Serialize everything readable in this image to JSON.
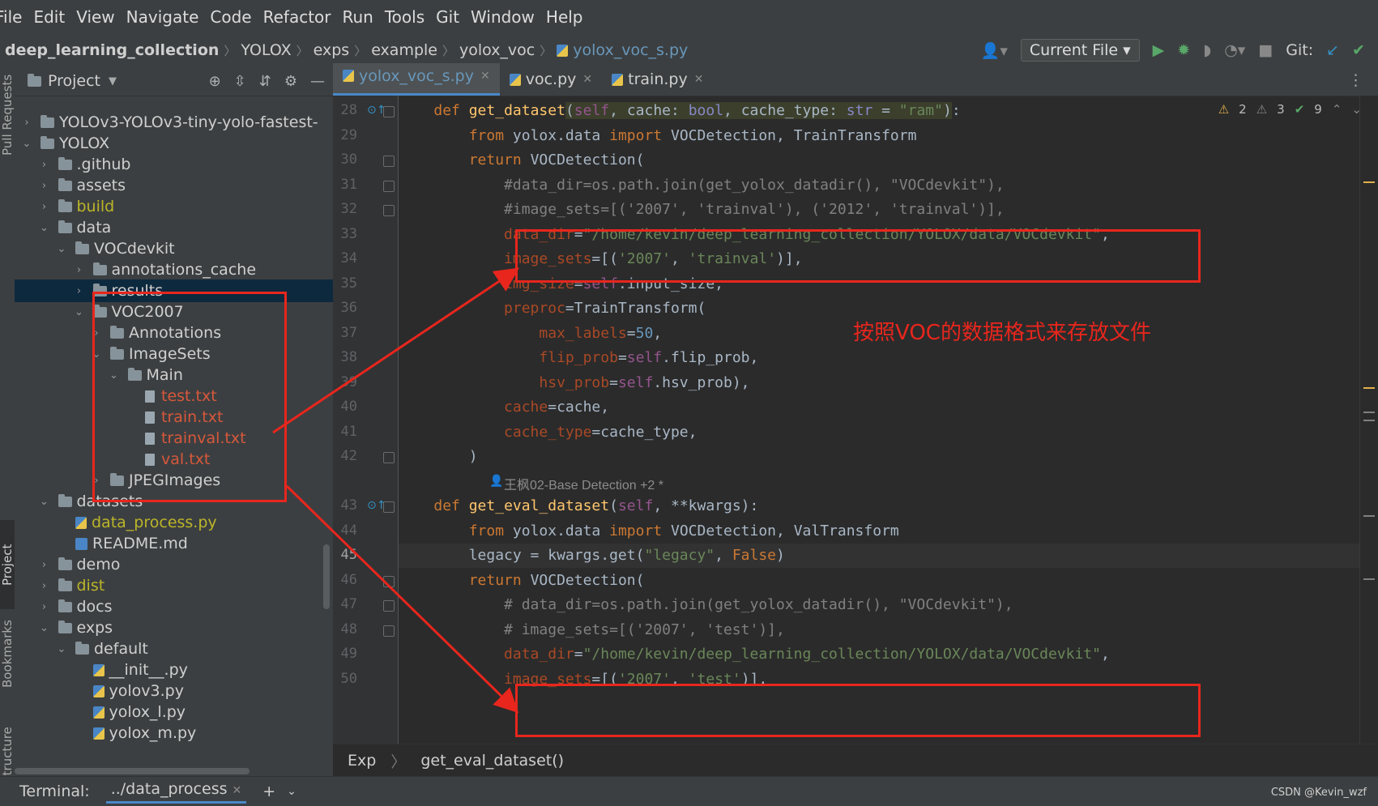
{
  "menu": [
    "File",
    "Edit",
    "View",
    "Navigate",
    "Code",
    "Refactor",
    "Run",
    "Tools",
    "Git",
    "Window",
    "Help"
  ],
  "breadcrumb": [
    "deep_learning_collection",
    "YOLOX",
    "exps",
    "example",
    "yolox_voc",
    "yolox_voc_s.py"
  ],
  "nav": {
    "run_config": "Current File",
    "git_label": "Git:"
  },
  "sidebar_tabs": {
    "pull_requests": "Pull Requests",
    "project": "Project",
    "bookmarks": "Bookmarks",
    "structure": "Structure"
  },
  "project": {
    "title": "Project",
    "tree": [
      {
        "label": "YOLOv3-YOLOv3-tiny-yolo-fastest-",
        "depth": 1,
        "type": "folder",
        "expanded": false
      },
      {
        "label": "YOLOX",
        "depth": 1,
        "type": "folder",
        "expanded": true
      },
      {
        "label": ".github",
        "depth": 2,
        "type": "folder",
        "expanded": false
      },
      {
        "label": "assets",
        "depth": 2,
        "type": "folder",
        "expanded": false
      },
      {
        "label": "build",
        "depth": 2,
        "type": "folder",
        "expanded": false,
        "color": "excluded"
      },
      {
        "label": "data",
        "depth": 2,
        "type": "folder",
        "expanded": true
      },
      {
        "label": "VOCdevkit",
        "depth": 3,
        "type": "folder",
        "expanded": true
      },
      {
        "label": "annotations_cache",
        "depth": 4,
        "type": "folder",
        "expanded": false
      },
      {
        "label": "results",
        "depth": 4,
        "type": "folder",
        "expanded": false,
        "selected": true
      },
      {
        "label": "VOC2007",
        "depth": 4,
        "type": "folder",
        "expanded": true
      },
      {
        "label": "Annotations",
        "depth": 5,
        "type": "folder",
        "expanded": false
      },
      {
        "label": "ImageSets",
        "depth": 5,
        "type": "folder",
        "expanded": true
      },
      {
        "label": "Main",
        "depth": 6,
        "type": "folder",
        "expanded": true
      },
      {
        "label": "test.txt",
        "depth": 7,
        "type": "txt",
        "color": "untracked"
      },
      {
        "label": "train.txt",
        "depth": 7,
        "type": "txt",
        "color": "untracked"
      },
      {
        "label": "trainval.txt",
        "depth": 7,
        "type": "txt",
        "color": "untracked"
      },
      {
        "label": "val.txt",
        "depth": 7,
        "type": "txt",
        "color": "untracked"
      },
      {
        "label": "JPEGImages",
        "depth": 5,
        "type": "folder",
        "expanded": false
      },
      {
        "label": "datasets",
        "depth": 2,
        "type": "folder",
        "expanded": true
      },
      {
        "label": "data_process.py",
        "depth": 3,
        "type": "py",
        "color": "excluded"
      },
      {
        "label": "README.md",
        "depth": 3,
        "type": "md"
      },
      {
        "label": "demo",
        "depth": 2,
        "type": "folder",
        "expanded": false
      },
      {
        "label": "dist",
        "depth": 2,
        "type": "folder",
        "expanded": false,
        "color": "excluded"
      },
      {
        "label": "docs",
        "depth": 2,
        "type": "folder",
        "expanded": false
      },
      {
        "label": "exps",
        "depth": 2,
        "type": "folder",
        "expanded": true
      },
      {
        "label": "default",
        "depth": 3,
        "type": "folder",
        "expanded": true
      },
      {
        "label": "__init__.py",
        "depth": 4,
        "type": "py"
      },
      {
        "label": "yolov3.py",
        "depth": 4,
        "type": "py"
      },
      {
        "label": "yolox_l.py",
        "depth": 4,
        "type": "py"
      },
      {
        "label": "yolox_m.py",
        "depth": 4,
        "type": "py"
      }
    ]
  },
  "tabs": [
    {
      "label": "yolox_voc_s.py",
      "active": true
    },
    {
      "label": "voc.py",
      "active": false
    },
    {
      "label": "train.py",
      "active": false
    }
  ],
  "inspections": {
    "warnings": "2",
    "weak": "3",
    "ok": "9"
  },
  "code_lines": [
    {
      "n": "28",
      "html": "    <span class='kw'>def</span> <span class='fn'>get_dataset</span><span class='hl'>(<span class='self'>self</span>, cache: <span class='bi'>bool</span>, cache_type: <span class='bi'>str</span> = <span class='str'>\"ram\"</span>)</span>:"
    },
    {
      "n": "29",
      "html": "        <span class='kw'>from</span> yolox.data <span class='kw'>import</span> VOCDetection, TrainTransform"
    },
    {
      "n": "30",
      "html": "        <span class='kw'>return</span> VOCDetection("
    },
    {
      "n": "31",
      "html": "            <span class='cmt'>#data_dir=os.path.join(get_yolox_datadir(), \"VOCdevkit\"),</span>"
    },
    {
      "n": "32",
      "html": "            <span class='cmt'>#image_sets=[('2007', 'trainval'), ('2012', 'trainval')],</span>"
    },
    {
      "n": "33",
      "html": "            <span class='param'>data_dir</span>=<span class='str'>\"/home/kevin/deep_learning_collection/YOLOX/data/VOCdevkit\"</span>,"
    },
    {
      "n": "34",
      "html": "            <span class='param'>image_sets</span>=[(<span class='str'>'2007'</span>, <span class='str'>'trainval'</span>)],"
    },
    {
      "n": "35",
      "html": "            <span class='param'>img_size</span>=<span class='self'>self</span>.input_size,"
    },
    {
      "n": "36",
      "html": "            <span class='param'>preproc</span>=TrainTransform("
    },
    {
      "n": "37",
      "html": "                <span class='param'>max_labels</span>=<span class='num'>50</span>,"
    },
    {
      "n": "38",
      "html": "                <span class='param'>flip_prob</span>=<span class='self'>self</span>.flip_prob,"
    },
    {
      "n": "39",
      "html": "                <span class='param'>hsv_prob</span>=<span class='self'>self</span>.hsv_prob),"
    },
    {
      "n": "40",
      "html": "            <span class='param'>cache</span>=cache,"
    },
    {
      "n": "41",
      "html": "            <span class='param'>cache_type</span>=cache_type,"
    },
    {
      "n": "42",
      "html": "        )"
    },
    {
      "n": "",
      "html": ""
    },
    {
      "n": "43",
      "html": "    <span class='kw'>def</span> <span class='fn'>get_eval_dataset</span>(<span class='self'>self</span>, **kwargs):"
    },
    {
      "n": "44",
      "html": "        <span class='kw'>from</span> yolox.data <span class='kw'>import</span> VOCDetection, ValTransform"
    },
    {
      "n": "45",
      "html": "        legacy = kwargs.get(<span class='str'>\"legacy\"</span>, <span class='kw'>False</span>)"
    },
    {
      "n": "46",
      "html": "        <span class='kw'>return</span> VOCDetection("
    },
    {
      "n": "47",
      "html": "            <span class='cmt'># data_dir=os.path.join(get_yolox_datadir(), \"VOCdevkit\"),</span>"
    },
    {
      "n": "48",
      "html": "            <span class='cmt'># image_sets=[('2007', 'test')],</span>"
    },
    {
      "n": "49",
      "html": "            <span class='param'>data_dir</span>=<span class='str'>\"/home/kevin/deep_learning_collection/YOLOX/data/VOCdevkit\"</span>,"
    },
    {
      "n": "50",
      "html": "            <span class='param'>image_sets</span>=[(<span class='str'>'2007'</span>, <span class='str'>'test'</span>)],"
    }
  ],
  "author_hint": "王枫02-Base Detection +2 *",
  "annotation_text": "按照VOC的数据格式来存放文件",
  "code_breadcrumb": {
    "a": "Exp",
    "b": "get_eval_dataset()"
  },
  "terminal": {
    "label": "Terminal:",
    "tab": "../data_process"
  },
  "watermark": "CSDN @Kevin_wzf"
}
